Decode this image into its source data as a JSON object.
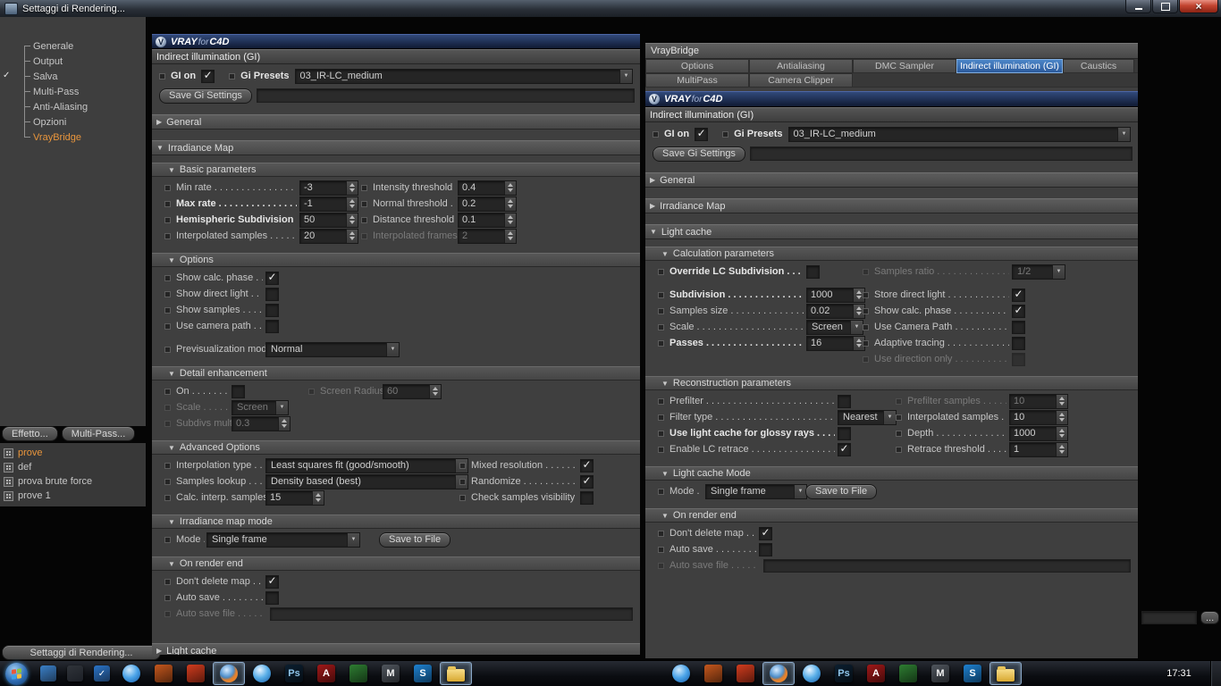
{
  "window": {
    "title": "Settaggi di Rendering..."
  },
  "sidebar": {
    "tree": [
      {
        "label": "Generale"
      },
      {
        "label": "Output"
      },
      {
        "label": "Salva",
        "gutter_check": true
      },
      {
        "label": "Multi-Pass"
      },
      {
        "label": "Anti-Aliasing"
      },
      {
        "label": "Opzioni"
      },
      {
        "label": "VrayBridge",
        "selected": true
      }
    ],
    "effect_button": "Effetto...",
    "multipass_button": "Multi-Pass...",
    "presets": [
      {
        "label": "prove",
        "selected": true
      },
      {
        "label": "def"
      },
      {
        "label": "prova brute force"
      },
      {
        "label": "prove 1"
      }
    ],
    "settings_button": "Settaggi di Rendering..."
  },
  "left_panel": {
    "brand": {
      "vray": "VRAY",
      "mid": "for",
      "c4d": "C4D"
    },
    "gi_title": "Indirect illumination (GI)",
    "gi_on": {
      "label": "GI on",
      "checked": true
    },
    "presets_label": "Gi Presets",
    "presets_value": "03_IR-LC_medium",
    "save_gi_button": "Save Gi Settings",
    "sections": [
      {
        "kind": "header",
        "label": "General",
        "collapsed": true
      },
      {
        "kind": "header",
        "label": "Irradiance Map",
        "collapsed": false
      },
      {
        "kind": "sub",
        "label": "Basic parameters",
        "rows": [
          {
            "cols": [
              {
                "label": "Min rate",
                "ctrl": "spin",
                "value": "-3"
              },
              {
                "label": "Intensity threshold",
                "ctrl": "spin",
                "value": "0.4"
              }
            ]
          },
          {
            "cols": [
              {
                "label": "Max rate",
                "bold": true,
                "ctrl": "spin",
                "value": "-1"
              },
              {
                "label": "Normal threshold",
                "ctrl": "spin",
                "value": "0.2"
              }
            ]
          },
          {
            "cols": [
              {
                "label": "Hemispheric Subdivision",
                "bold": true,
                "ctrl": "spin",
                "value": "50"
              },
              {
                "label": "Distance threshold",
                "ctrl": "spin",
                "value": "0.1"
              }
            ]
          },
          {
            "cols": [
              {
                "label": "Interpolated samples",
                "ctrl": "spin",
                "value": "20"
              },
              {
                "label": "Interpolated frames",
                "disabled": true,
                "ctrl": "spin",
                "value": "2"
              }
            ]
          }
        ]
      },
      {
        "kind": "sub",
        "label": "Options",
        "rows": [
          {
            "cols": [
              {
                "label": "Show calc. phase",
                "ctrl": "check",
                "checked": true
              }
            ]
          },
          {
            "cols": [
              {
                "label": "Show direct light",
                "ctrl": "check"
              }
            ]
          },
          {
            "cols": [
              {
                "label": "Show samples",
                "ctrl": "check"
              }
            ]
          },
          {
            "cols": [
              {
                "label": "Use camera path",
                "ctrl": "check"
              }
            ]
          },
          {
            "gap": true
          },
          {
            "cols": [
              {
                "label": "Previsualization mode",
                "ctrl": "drop",
                "value": "Normal"
              }
            ]
          }
        ]
      },
      {
        "kind": "sub",
        "label": "Detail enhancement",
        "rows": [
          {
            "cols": [
              {
                "label": "On",
                "ctrl": "check"
              },
              {
                "label": "Screen Radius",
                "disabled": true,
                "ctrl": "spin",
                "value": "60"
              }
            ]
          },
          {
            "cols": [
              {
                "label": "Scale",
                "disabled": true,
                "ctrl": "drop",
                "value": "Screen"
              }
            ]
          },
          {
            "cols": [
              {
                "label": "Subdivs mult",
                "disabled": true,
                "ctrl": "spin",
                "value": "0.3"
              }
            ]
          }
        ]
      },
      {
        "kind": "sub",
        "label": "Advanced Options",
        "rows": [
          {
            "cols": [
              {
                "label": "Interpolation type",
                "ctrl": "drop",
                "value": "Least squares fit (good/smooth)"
              },
              {
                "label": "Mixed resolution",
                "ctrl": "check",
                "checked": true
              }
            ]
          },
          {
            "cols": [
              {
                "label": "Samples lookup",
                "ctrl": "drop",
                "value": "Density based (best)"
              },
              {
                "label": "Randomize",
                "ctrl": "check",
                "checked": true
              }
            ]
          },
          {
            "cols": [
              {
                "label": "Calc. interp. samples",
                "ctrl": "spin",
                "value": "15"
              },
              {
                "label": "Check samples visibility",
                "ctrl": "check"
              }
            ]
          }
        ]
      },
      {
        "kind": "sub",
        "label": "Irradiance map mode",
        "rows": [
          {
            "cols": [
              {
                "label": "Mode",
                "ctrl": "drop",
                "value": "Single frame"
              },
              {
                "ctrl": "button",
                "label": "Save to File"
              }
            ]
          }
        ]
      },
      {
        "kind": "sub",
        "label": "On render end",
        "rows": [
          {
            "cols": [
              {
                "label": "Don't delete map",
                "ctrl": "check",
                "checked": true
              }
            ]
          },
          {
            "cols": [
              {
                "label": "Auto save",
                "ctrl": "check"
              }
            ]
          },
          {
            "cols": [
              {
                "label": "Auto save file",
                "disabled": true,
                "ctrl": "strip"
              }
            ]
          }
        ]
      },
      {
        "kind": "header",
        "label": "Light cache",
        "collapsed": true
      }
    ]
  },
  "right_panel": {
    "panel_title": "VrayBridge",
    "tabs_row1": [
      {
        "label": "Options"
      },
      {
        "label": "Antialiasing"
      },
      {
        "label": "DMC Sampler"
      },
      {
        "label": "Indirect illumination (GI)",
        "selected": true
      },
      {
        "label": "Caustics"
      }
    ],
    "tabs_row2": [
      {
        "label": "MultiPass"
      },
      {
        "label": "Camera Clipper"
      }
    ],
    "brand": {
      "vray": "VRAY",
      "mid": "for",
      "c4d": "C4D"
    },
    "gi_title": "Indirect illumination (GI)",
    "gi_on": {
      "label": "GI on",
      "checked": true
    },
    "presets_label": "Gi Presets",
    "presets_value": "03_IR-LC_medium",
    "save_gi_button": "Save Gi Settings",
    "sections": [
      {
        "kind": "header",
        "label": "General",
        "collapsed": true
      },
      {
        "kind": "header",
        "label": "Irradiance Map",
        "collapsed": true
      },
      {
        "kind": "header",
        "label": "Light cache",
        "collapsed": false
      },
      {
        "kind": "sub",
        "label": "Calculation parameters",
        "rows": [
          {
            "cols": [
              {
                "label": "Override LC Subdivision",
                "bold": true,
                "ctrl": "check"
              },
              {
                "label": "Samples ratio",
                "disabled": true,
                "ctrl": "drop",
                "value": "1/2"
              }
            ]
          },
          {
            "gap": true
          },
          {
            "cols": [
              {
                "label": "Subdivision",
                "bold": true,
                "ctrl": "spin",
                "value": "1000"
              },
              {
                "label": "Store direct light",
                "ctrl": "check",
                "checked": true
              }
            ]
          },
          {
            "cols": [
              {
                "label": "Samples size",
                "ctrl": "spin",
                "value": "0.02"
              },
              {
                "label": "Show calc. phase",
                "ctrl": "check",
                "checked": true
              }
            ]
          },
          {
            "cols": [
              {
                "label": "Scale",
                "ctrl": "drop",
                "value": "Screen"
              },
              {
                "label": "Use Camera Path",
                "ctrl": "check"
              }
            ]
          },
          {
            "cols": [
              {
                "label": "Passes",
                "bold": true,
                "ctrl": "spin",
                "value": "16"
              },
              {
                "label": "Adaptive tracing",
                "ctrl": "check"
              }
            ]
          },
          {
            "cols": [
              {},
              {
                "label": "Use direction only",
                "disabled": true,
                "ctrl": "check"
              }
            ]
          }
        ]
      },
      {
        "kind": "sub",
        "label": "Reconstruction parameters",
        "rows": [
          {
            "cols": [
              {
                "label": "Prefilter",
                "ctrl": "check"
              },
              {
                "label": "Prefilter samples",
                "disabled": true,
                "ctrl": "spin",
                "value": "10"
              }
            ]
          },
          {
            "cols": [
              {
                "label": "Filter type",
                "ctrl": "drop",
                "value": "Nearest"
              },
              {
                "label": "Interpolated samples",
                "ctrl": "spin",
                "value": "10"
              }
            ]
          },
          {
            "cols": [
              {
                "label": "Use light cache for glossy rays",
                "bold": true,
                "ctrl": "check"
              },
              {
                "label": "Depth",
                "ctrl": "spin",
                "value": "1000"
              }
            ]
          },
          {
            "cols": [
              {
                "label": "Enable LC retrace",
                "ctrl": "check",
                "checked": true
              },
              {
                "label": "Retrace threshold",
                "ctrl": "spin",
                "value": "1"
              }
            ]
          }
        ]
      },
      {
        "kind": "sub",
        "label": "Light cache Mode",
        "rows": [
          {
            "cols": [
              {
                "label": "Mode",
                "ctrl": "drop",
                "value": "Single frame"
              },
              {
                "ctrl": "button",
                "label": "Save to File"
              }
            ]
          }
        ]
      },
      {
        "kind": "sub",
        "label": "On render end",
        "rows": [
          {
            "cols": [
              {
                "label": "Don't delete map",
                "ctrl": "check",
                "checked": true
              }
            ]
          },
          {
            "cols": [
              {
                "label": "Auto save",
                "ctrl": "check"
              }
            ]
          },
          {
            "cols": [
              {
                "label": "Auto save file",
                "disabled": true,
                "ctrl": "strip"
              }
            ]
          }
        ]
      }
    ]
  },
  "misc": {
    "browse_button": "..."
  },
  "taskbar": {
    "clock": "17:31",
    "small_icons": [
      {
        "name": "messenger-icon",
        "bg": "#3a80c8",
        "glyph": ""
      },
      {
        "name": "console-icon",
        "bg": "#30343a",
        "glyph": ""
      },
      {
        "name": "update-check-icon",
        "bg": "#2a74c8",
        "glyph": "✓"
      }
    ],
    "apps": [
      {
        "name": "browser-globe-icon",
        "type": "orb",
        "c1": "#cfe8fa",
        "c2": "#4aa3e8",
        "c3": "#1b5fa8"
      },
      {
        "name": "flame-app-icon",
        "type": "tile",
        "bg": "#c5571d",
        "fg": "#ffd9a0",
        "glyph": ""
      },
      {
        "name": "orange-app-icon",
        "type": "tile",
        "bg": "#d23c1e",
        "fg": "#ffffff",
        "glyph": ""
      },
      {
        "name": "firefox-icon",
        "type": "orb",
        "c1": "#d8ecff",
        "c2": "#3f86c8",
        "c3": "#1a4f8a",
        "crescent": "#e8822a",
        "active": true
      },
      {
        "name": "internet-orb-icon",
        "type": "orb",
        "c1": "#e8f4ff",
        "c2": "#58aee8",
        "c3": "#1f62a8"
      },
      {
        "name": "photoshop-icon",
        "type": "tile",
        "bg": "#0c1f30",
        "fg": "#8fc4e8",
        "glyph": "Ps"
      },
      {
        "name": "adobe-reader-icon",
        "type": "tile",
        "bg": "#a01818",
        "fg": "#ffffff",
        "glyph": "A"
      },
      {
        "name": "green-app-icon",
        "type": "tile",
        "bg": "#2e7d32",
        "fg": "#eaffea",
        "glyph": ""
      },
      {
        "name": "m-app-icon",
        "type": "tile",
        "bg": "#50565e",
        "fg": "#f0f0f0",
        "glyph": "M"
      },
      {
        "name": "skype-icon",
        "type": "tile",
        "bg": "#1e82d2",
        "fg": "#ffffff",
        "glyph": "S"
      },
      {
        "name": "explorer-folder-icon",
        "type": "folder",
        "active": true
      }
    ]
  }
}
